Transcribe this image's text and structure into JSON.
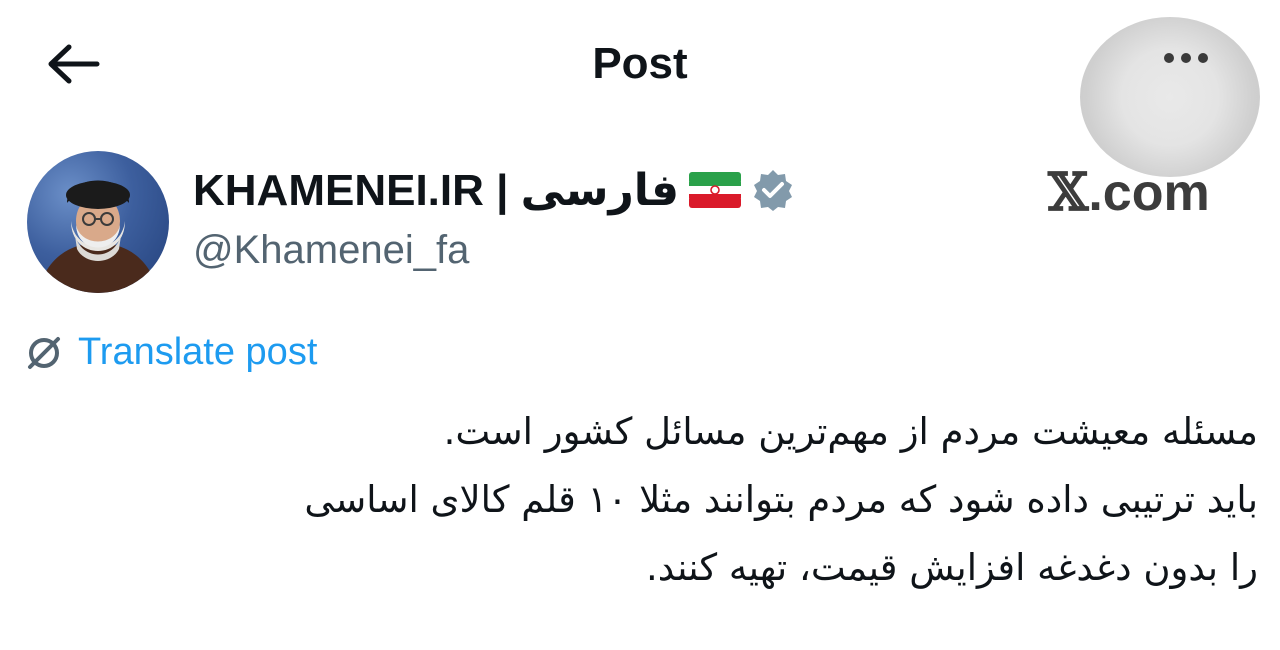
{
  "header": {
    "title": "Post",
    "back_icon": "arrow-left-icon",
    "more_icon": "more-horizontal-icon"
  },
  "account": {
    "display_name": "KHAMENEI.IR | فارسی",
    "flag_icon": "iran-flag-icon",
    "verified_icon": "verified-badge-icon",
    "handle": "@Khamenei_fa",
    "verified_color": "#829aab"
  },
  "watermark": {
    "x": "𝕏",
    "domain": ".com"
  },
  "translate": {
    "label": "Translate post",
    "icon": "globe-slash-icon",
    "color": "#1d9bf0"
  },
  "post": {
    "lines": [
      "مسئله معیشت مردم از مهم‌ترین مسائل کشور است.",
      "باید ترتیبی داده شود که مردم بتوانند مثلا ۱۰ قلم کالای اساسی",
      "را بدون دغدغه افزایش قیمت، تهیه کنند."
    ]
  }
}
